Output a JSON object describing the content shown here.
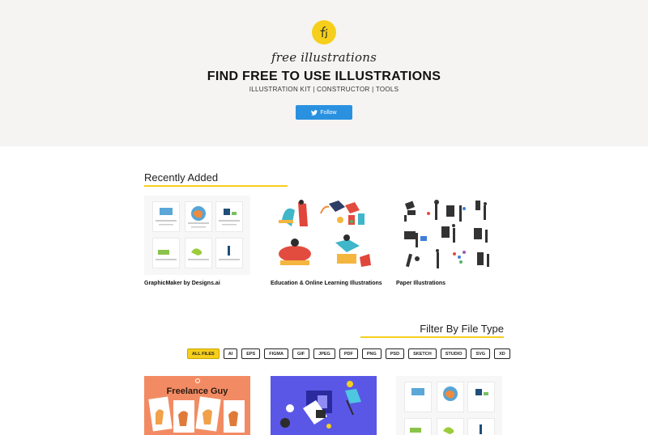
{
  "hero": {
    "logo_letter": "fi",
    "brand": "free illustrations",
    "title": "FIND FREE TO USE ILLUSTRATIONS",
    "subtitle": "ILLUSTRATION KIT | CONSTRUCTOR | TOOLS",
    "follow_label": "Follow"
  },
  "recent": {
    "heading": "Recently Added",
    "cards": [
      {
        "caption": "GraphicMaker by Designs.ai"
      },
      {
        "caption": "Education & Online Learning Illustrations"
      },
      {
        "caption": "Paper Illustrations"
      }
    ]
  },
  "filter": {
    "heading": "Filter By File Type",
    "types": [
      "ALL FILES",
      "AI",
      "EPS",
      "FIGMA",
      "GIF",
      "JPEG",
      "PDF",
      "PNG",
      "PSD",
      "SKETCH",
      "STUDIO",
      "SVG",
      "XD"
    ],
    "active": "ALL FILES"
  },
  "results": {
    "cards": [
      {
        "title": "Freelance Guy"
      },
      {
        "title": ""
      },
      {
        "title": ""
      }
    ]
  },
  "colors": {
    "accent": "#f6cf1c",
    "twitter": "#2a91e0",
    "hero_bg": "#f5f4f2"
  }
}
